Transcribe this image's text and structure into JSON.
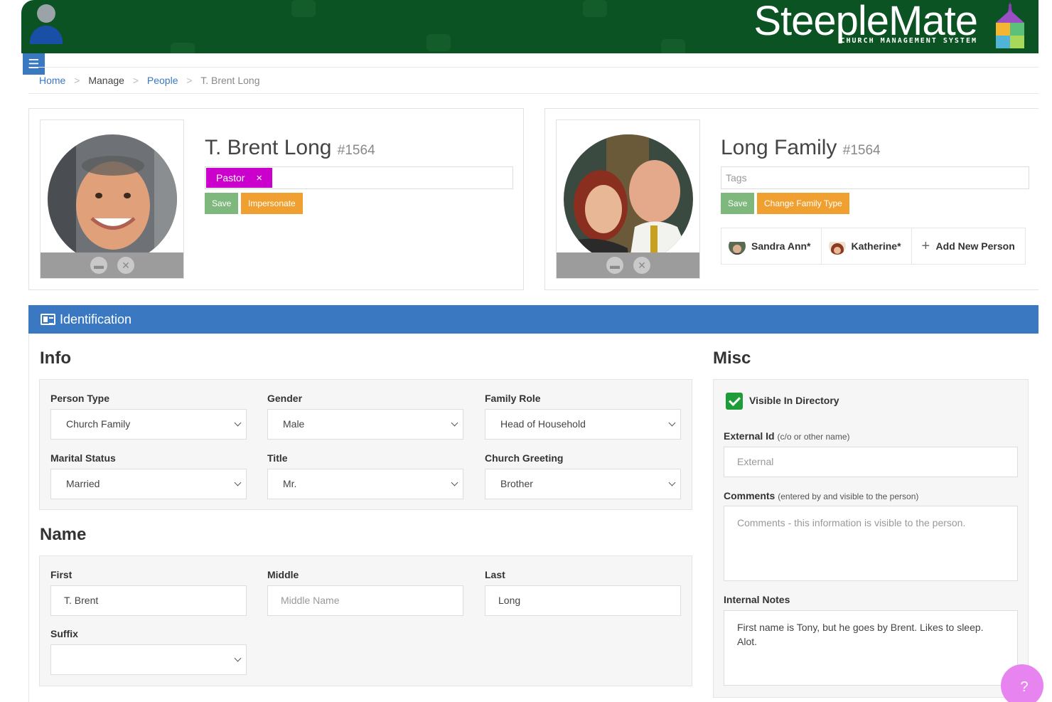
{
  "header": {
    "brand": "SteepleMate",
    "brand_sub": "CHURCH MANAGEMENT SYSTEM",
    "bg_color": "#0b5323"
  },
  "breadcrumb": {
    "home": "Home",
    "manage": "Manage",
    "people": "People",
    "current": "T. Brent Long",
    "separator": ">"
  },
  "person_card": {
    "name": "T. Brent Long",
    "number": "#1564",
    "tags": [
      {
        "label": "Pastor",
        "remove": "×"
      }
    ],
    "save_label": "Save",
    "impersonate_label": "Impersonate"
  },
  "family_card": {
    "name": "Long Family",
    "number": "#1564",
    "tags_placeholder": "Tags",
    "save_label": "Save",
    "change_type_label": "Change Family Type",
    "members": [
      {
        "name": "Sandra Ann*"
      },
      {
        "name": "Katherine*"
      }
    ],
    "add_person_label": "Add New Person"
  },
  "identification": {
    "title": "Identification",
    "info_heading": "Info",
    "misc_heading": "Misc",
    "name_heading": "Name",
    "fields": {
      "person_type": {
        "label": "Person Type",
        "value": "Church Family"
      },
      "gender": {
        "label": "Gender",
        "value": "Male"
      },
      "family_role": {
        "label": "Family Role",
        "value": "Head of Household"
      },
      "marital_status": {
        "label": "Marital Status",
        "value": "Married"
      },
      "title": {
        "label": "Title",
        "value": "Mr."
      },
      "church_greeting": {
        "label": "Church Greeting",
        "value": "Brother"
      },
      "first": {
        "label": "First",
        "value": "T. Brent"
      },
      "middle": {
        "label": "Middle",
        "placeholder": "Middle Name"
      },
      "last": {
        "label": "Last",
        "value": "Long"
      },
      "suffix": {
        "label": "Suffix",
        "value": ""
      }
    },
    "misc": {
      "visible_label": "Visible In Directory",
      "visible_checked": true,
      "external_label": "External Id",
      "external_hint": "(c/o or other name)",
      "external_placeholder": "External",
      "comments_label": "Comments",
      "comments_hint": "(entered by and visible to the person)",
      "comments_placeholder": "Comments - this information is visible to the person.",
      "notes_label": "Internal Notes",
      "notes_value": "First name is Tony, but he goes by Brent. Likes to sleep. Alot."
    }
  },
  "help": {
    "label": "?"
  },
  "colors": {
    "accent_blue": "#3a78c2",
    "tag_magenta": "#cc00cc",
    "save_green": "#7fb87d",
    "action_orange": "#f0a030"
  }
}
